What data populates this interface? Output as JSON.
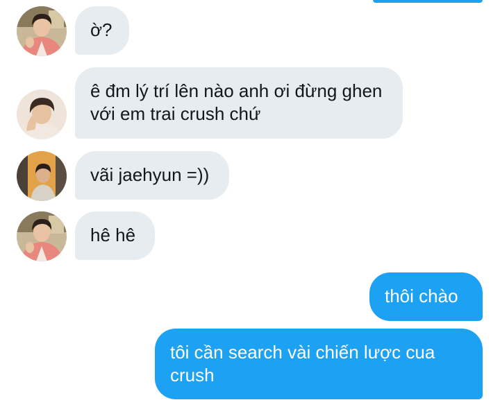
{
  "conversation": {
    "messages": [
      {
        "direction": "incoming",
        "text": "ờ?",
        "avatar": "avatar-portrait-pink-shirt"
      },
      {
        "direction": "incoming",
        "text": "ê đm lý trí lên nào anh ơi đừng ghen với em trai crush chứ",
        "avatar": "avatar-portrait-hand-on-cheek"
      },
      {
        "direction": "incoming",
        "text": "vãi jaehyun =))",
        "avatar": "avatar-portrait-orange-background"
      },
      {
        "direction": "incoming",
        "text": "hê hê",
        "avatar": "avatar-portrait-pink-shirt"
      },
      {
        "direction": "outgoing",
        "text": "thôi chào"
      },
      {
        "direction": "outgoing",
        "text": "tôi cần search vài chiến lược cua crush"
      }
    ]
  },
  "colors": {
    "outgoing_bubble": "#1da1f2",
    "incoming_bubble": "#e6ecf0",
    "incoming_text": "#14171a",
    "outgoing_text": "#ffffff"
  }
}
